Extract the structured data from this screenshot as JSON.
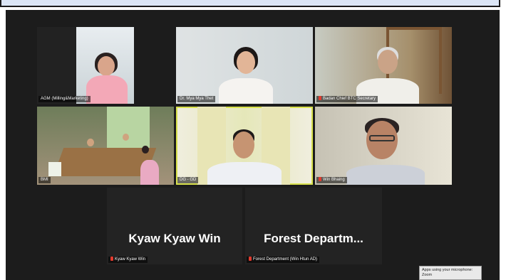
{
  "participants": [
    {
      "name": "AGM (Milling&Marketing)",
      "muted": false
    },
    {
      "name": "Dr. Mya Mya Thet",
      "muted": false
    },
    {
      "name": "Badan Chief BTC Secretary",
      "muted": true
    },
    {
      "name": "BMI",
      "muted": false
    },
    {
      "name": "DG - GD",
      "muted": false
    },
    {
      "name": "Win Bhaing",
      "muted": true
    },
    {
      "name": "Kyaw Kyaw Win",
      "muted": true,
      "display_name": "Kyaw Kyaw Win"
    },
    {
      "name": "Forest Department (Win Htun AD)",
      "muted": true,
      "display_name": "Forest  Departm..."
    }
  ],
  "notification": {
    "text": "Apps using your microphone: Zoom"
  },
  "colors": {
    "background": "#1c1c1c",
    "active_speaker": "#d9e24c",
    "mute": "#e23b2e"
  }
}
